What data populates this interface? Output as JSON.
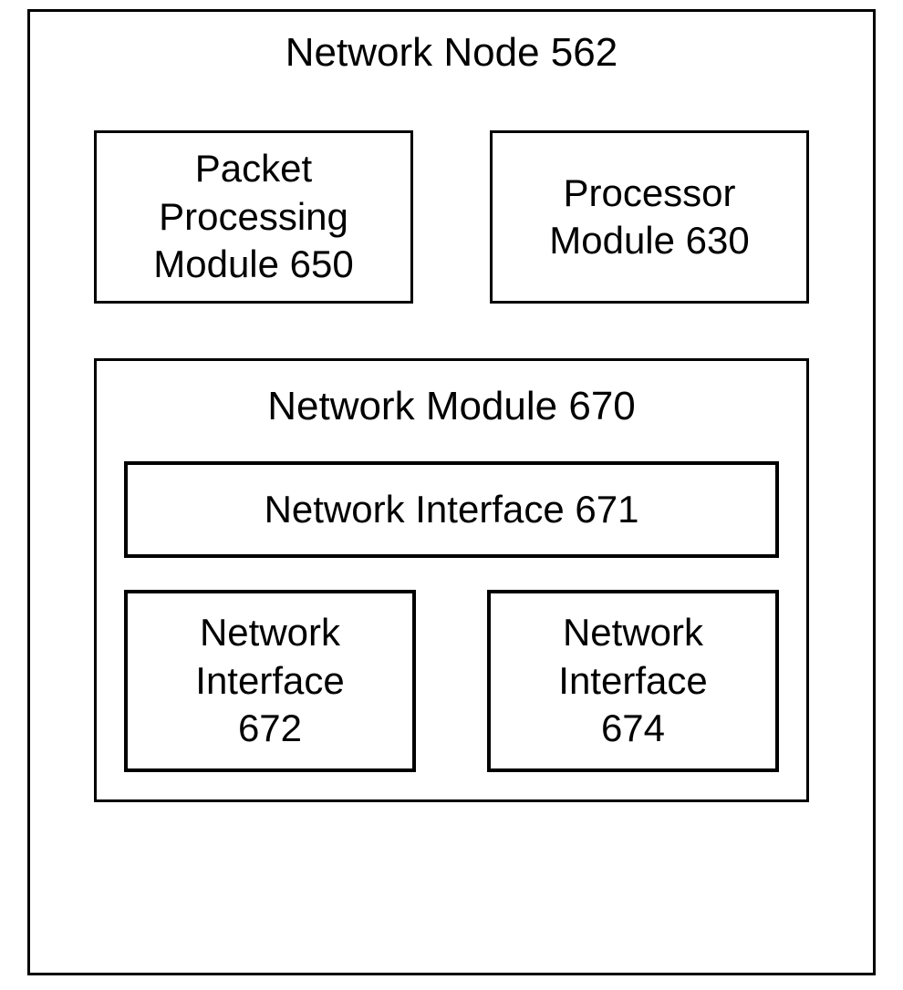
{
  "container": {
    "title": "Network Node 562"
  },
  "packet_processing": {
    "line1": "Packet",
    "line2": "Processing",
    "line3": "Module 650"
  },
  "processor": {
    "line1": "Processor",
    "line2": "Module 630"
  },
  "network_module": {
    "title": "Network Module 670",
    "interface_full": "Network Interface 671",
    "interface_left": {
      "line1": "Network",
      "line2": "Interface",
      "line3": "672"
    },
    "interface_right": {
      "line1": "Network",
      "line2": "Interface",
      "line3": "674"
    }
  }
}
